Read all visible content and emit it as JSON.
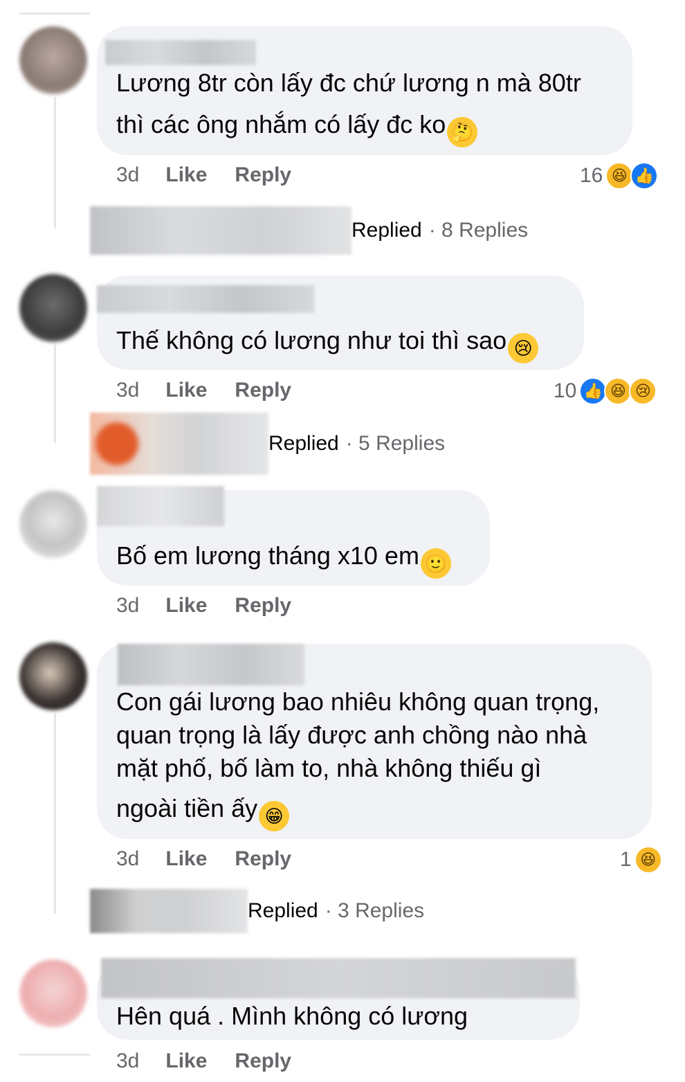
{
  "comments": [
    {
      "text_lines": [
        "Lương 8tr còn lấy đc chứ lương n mà 80tr",
        "thì các ông nhắm có lấy đc ko"
      ],
      "emoji": "🤔",
      "time": "3d",
      "like_label": "Like",
      "reply_label": "Reply",
      "reaction_count": "16",
      "reaction_icons": [
        "haha-icon",
        "like-icon"
      ],
      "replies_label": "Replied",
      "replies_count": "· 8 Replies"
    },
    {
      "text_lines": [
        "Thế không có lương như toi thì sao"
      ],
      "emoji": "😢",
      "time": "3d",
      "like_label": "Like",
      "reply_label": "Reply",
      "reaction_count": "10",
      "reaction_icons": [
        "like-icon",
        "haha-icon",
        "sad-icon"
      ],
      "replies_label": "Replied",
      "replies_count": "· 5 Replies"
    },
    {
      "text_lines": [
        "Bố em lương tháng x10 em"
      ],
      "emoji": "🙂",
      "time": "3d",
      "like_label": "Like",
      "reply_label": "Reply"
    },
    {
      "text_lines": [
        "Con gái lương bao nhiêu không quan trọng,",
        "quan trọng là lấy được anh chồng nào nhà",
        "mặt phố, bố làm to, nhà không thiếu gì",
        "ngoài tiền ấy"
      ],
      "emoji": "😁",
      "time": "3d",
      "like_label": "Like",
      "reply_label": "Reply",
      "reaction_count": "1",
      "reaction_icons": [
        "haha-icon"
      ],
      "replies_label": "Replied",
      "replies_count": "· 3 Replies"
    },
    {
      "text_lines": [
        "Hên quá . Mình không có lương"
      ],
      "time": "3d",
      "like_label": "Like",
      "reply_label": "Reply"
    }
  ],
  "colors": {
    "bubble": "#f0f2f5",
    "meta_text": "#65676b",
    "like_blue": "#1877f2",
    "emoji_yellow": "#f7b928"
  }
}
